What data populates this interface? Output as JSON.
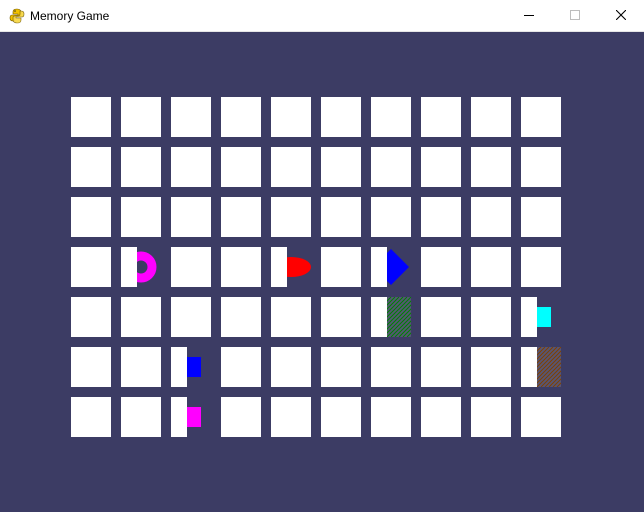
{
  "window": {
    "title": "Memory Game",
    "icon": "python-snake-icon",
    "controls": [
      "minimize",
      "maximize",
      "close"
    ]
  },
  "colors": {
    "background": "#3c3c64",
    "tile_cover": "#ffffff",
    "titlebar": "#ffffff"
  },
  "board": {
    "columns": 10,
    "rows": 7,
    "revealing_tiles": [
      {
        "row": 3,
        "col": 1,
        "shape": "donut",
        "color": "#ff00ff",
        "cover_fraction": 0.4
      },
      {
        "row": 3,
        "col": 4,
        "shape": "oval",
        "color": "#ff0000",
        "cover_fraction": 0.4
      },
      {
        "row": 3,
        "col": 6,
        "shape": "diamond",
        "color": "#0000ff",
        "cover_fraction": 0.4
      },
      {
        "row": 4,
        "col": 6,
        "shape": "lines",
        "color": "#008000",
        "cover_fraction": 0.4
      },
      {
        "row": 4,
        "col": 9,
        "shape": "square",
        "color": "#00ffff",
        "cover_fraction": 0.4
      },
      {
        "row": 5,
        "col": 2,
        "shape": "square",
        "color": "#0000ff",
        "cover_fraction": 0.4
      },
      {
        "row": 5,
        "col": 9,
        "shape": "lines",
        "color": "#804000",
        "cover_fraction": 0.4
      },
      {
        "row": 6,
        "col": 2,
        "shape": "square",
        "color": "#ff00ff",
        "cover_fraction": 0.4
      }
    ]
  }
}
